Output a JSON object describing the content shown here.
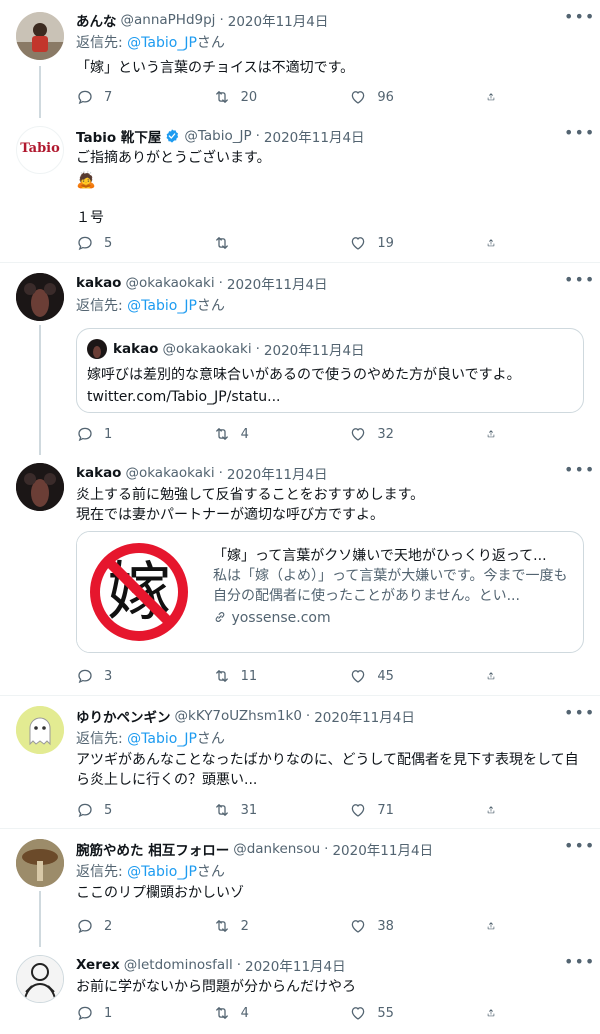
{
  "tweets": [
    {
      "name": "あんな",
      "handle": "@annaPHd9pj",
      "date": "2020年11月4日",
      "reply_prefix": "返信先: ",
      "reply_mention": "@Tabio_JP",
      "reply_suffix": "さん",
      "text": "「嫁」という言葉のチョイスは不適切です。",
      "replies": "7",
      "retweets": "20",
      "likes": "96"
    },
    {
      "name": "Tabio 靴下屋",
      "handle": "@Tabio_JP",
      "date": "2020年11月4日",
      "text": "ご指摘ありがとうございます。",
      "emoji": "🙇",
      "text2": "１号",
      "replies": "5",
      "retweets": "",
      "likes": "19"
    },
    {
      "name": "kakao",
      "handle": "@okakaokaki",
      "date": "2020年11月4日",
      "reply_prefix": "返信先: ",
      "reply_mention": "@Tabio_JP",
      "reply_suffix": "さん",
      "quote": {
        "name": "kakao",
        "handle": "@okakaokaki",
        "date": "2020年11月4日",
        "text": "嫁呼びは差別的な意味合いがあるので使うのやめた方が良いですよ。",
        "link": "twitter.com/Tabio_JP/statu..."
      },
      "replies": "1",
      "retweets": "4",
      "likes": "32"
    },
    {
      "name": "kakao",
      "handle": "@okakaokaki",
      "date": "2020年11月4日",
      "text": "炎上する前に勉強して反省することをおすすめします。",
      "text2": "現在では妻かパートナーが適切な呼び方ですよ。",
      "card": {
        "title": "「嫁」って言葉がクソ嫌いで天地がひっくり返って...",
        "desc": "私は「嫁（よめ）」って言葉が大嫌いです。今まで一度も自分の配偶者に使ったことがありません。とい...",
        "domain": "yossense.com",
        "image_char": "嫁"
      },
      "replies": "3",
      "retweets": "11",
      "likes": "45"
    },
    {
      "name": "ゆりかペンギン",
      "handle": "@kKY7oUZhsm1k0",
      "date": "2020年11月4日",
      "reply_prefix": "返信先: ",
      "reply_mention": "@Tabio_JP",
      "reply_suffix": "さん",
      "text": "アツギがあんなことなったばかりなのに、どうして配偶者を見下す表現をして自ら炎上しに行くの？頭悪い...",
      "replies": "5",
      "retweets": "31",
      "likes": "71"
    },
    {
      "name": "腕筋やめた 相互フォロー",
      "handle": "@dankensou",
      "date": "2020年11月4日",
      "reply_prefix": "返信先: ",
      "reply_mention": "@Tabio_JP",
      "reply_suffix": "さん",
      "text": "ここのリプ欄頭おかしいゾ",
      "replies": "2",
      "retweets": "2",
      "likes": "38"
    },
    {
      "name": "Xerex",
      "handle": "@letdominosfall",
      "date": "2020年11月4日",
      "text": "お前に学がないから問題が分からんだけやろ",
      "replies": "1",
      "retweets": "4",
      "likes": "55"
    }
  ],
  "common": {
    "dot": "·",
    "more": "•••",
    "tabio_logo": "Tabio"
  },
  "colors": {
    "accent": "#1d9bf0",
    "muted": "#536471",
    "line": "#cfd9de"
  }
}
